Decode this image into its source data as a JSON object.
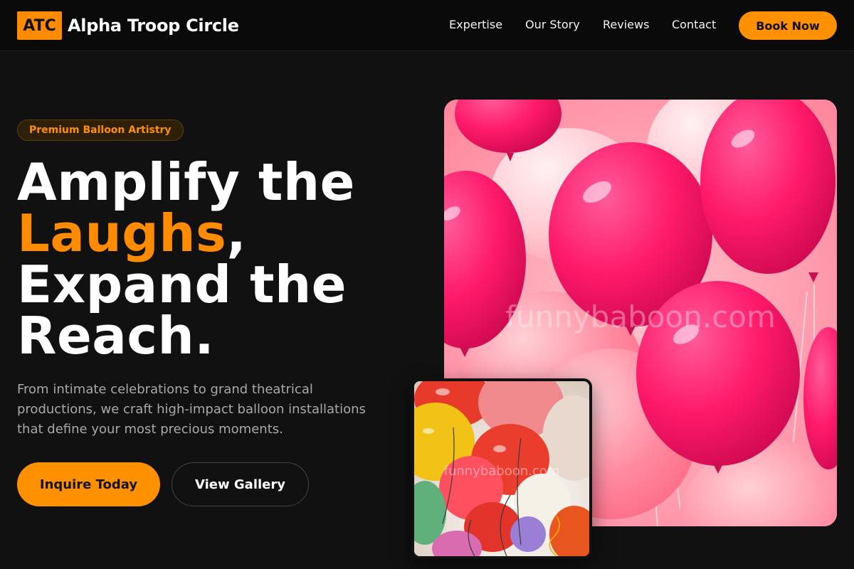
{
  "brand": {
    "badge": "ATC",
    "name": "Alpha Troop Circle"
  },
  "nav": {
    "links": [
      "Expertise",
      "Our Story",
      "Reviews",
      "Contact"
    ],
    "cta": "Book Now"
  },
  "hero": {
    "tag": "Premium Balloon Artistry",
    "headline": {
      "line1": "Amplify the",
      "accent": "Laughs",
      "comma": ",",
      "line3": "Expand the",
      "line4": "Reach."
    },
    "lede": "From intimate celebrations to grand theatrical productions, we craft high-impact balloon installations that define your most precious moments.",
    "primary_button": "Inquire Today",
    "secondary_button": "View Gallery"
  },
  "images": {
    "main_watermark": "funnybaboon.com",
    "inset_watermark": "funnybaboon.com"
  },
  "colors": {
    "accent": "#ff9100",
    "background": "#111111",
    "nav_background": "#0a0a0a",
    "balloon_pink": "#ff1a6a"
  }
}
